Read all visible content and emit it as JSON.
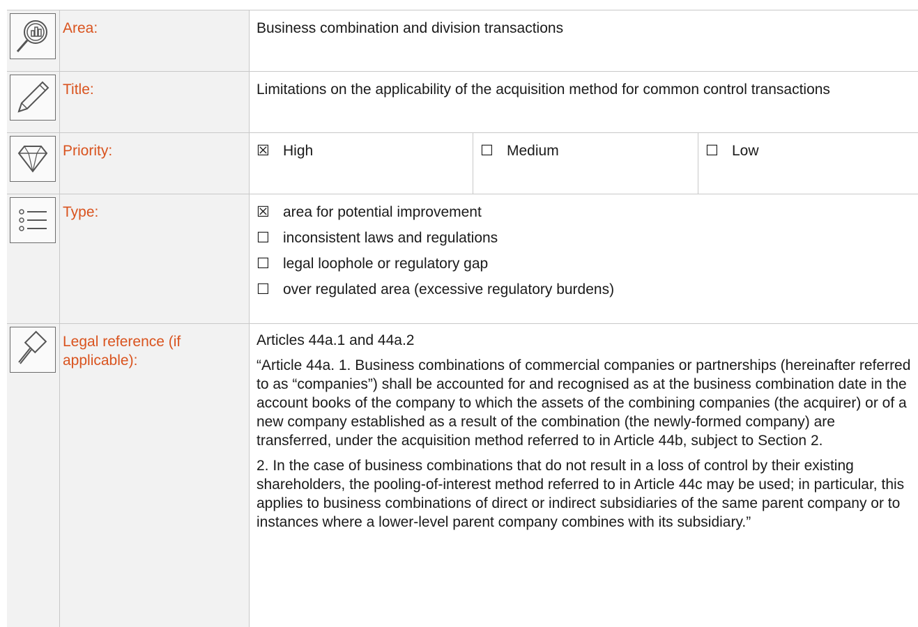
{
  "area": {
    "label": "Area:",
    "icon": "magnifier-chart-icon",
    "value": "Business combination and division transactions"
  },
  "title": {
    "label": "Title:",
    "icon": "pencil-icon",
    "value": "Limitations on the applicability of the acquisition method for common control transactions"
  },
  "priority": {
    "label": "Priority:",
    "icon": "diamond-icon",
    "options": [
      {
        "box": "☒",
        "text": "High"
      },
      {
        "box": "☐",
        "text": "Medium"
      },
      {
        "box": "☐",
        "text": "Low"
      }
    ]
  },
  "type": {
    "label": "Type:",
    "icon": "list-icon",
    "options": [
      {
        "box": "☒",
        "text": "area for potential improvement"
      },
      {
        "box": "☐",
        "text": "inconsistent laws and regulations"
      },
      {
        "box": "☐",
        "text": "legal loophole or regulatory gap"
      },
      {
        "box": "☐",
        "text": "over regulated area (excessive regulatory burdens)"
      }
    ]
  },
  "legal": {
    "label": "Legal reference (if applicable):",
    "icon": "gavel-icon",
    "paragraphs": [
      "Articles 44a.1 and 44a.2",
      "“Article 44a. 1. Business combinations of commercial companies or partnerships (hereinafter referred to as “companies”) shall be accounted for and recognised as at the business combination date in the account books of the company to which the assets of the combining companies (the acquirer) or of a new company established as a result of the combination (the newly-formed company) are transferred, under the acquisition method referred to in Article 44b, subject to Section 2.",
      "2. In the case of business combinations that do not result in a loss of control by their existing shareholders, the pooling-of-interest method referred to in Article 44c may be used; in particular, this applies to business combinations of direct or indirect subsidiaries of the same parent company or to instances where a lower-level parent company combines with its subsidiary.”"
    ]
  },
  "colors": {
    "label_orange": "#d9531e",
    "label_bg": "#f2f2f2",
    "grid_line": "#c8c8c8"
  }
}
